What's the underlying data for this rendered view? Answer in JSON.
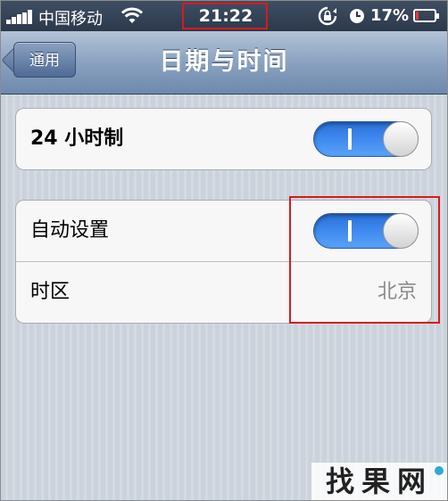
{
  "status_bar": {
    "carrier": "中国移动",
    "time": "21:22",
    "battery_percent": "17%",
    "battery_level": 0.17,
    "icons": [
      "signal-icon",
      "wifi-icon",
      "rotation-lock-icon",
      "alarm-icon",
      "battery-icon"
    ]
  },
  "nav": {
    "back_label": "通用",
    "title": "日期与时间"
  },
  "settings": {
    "group1": {
      "row_24h": {
        "label": "24 小时制",
        "toggle": "on"
      }
    },
    "group2": {
      "auto_set": {
        "label": "自动设置",
        "toggle": "on"
      },
      "timezone": {
        "label": "时区",
        "value": "北京"
      }
    }
  },
  "watermark": {
    "text": "找果网"
  },
  "colors": {
    "toggle_on": "#3f8af0",
    "highlight": "#d9191e",
    "nav_bar": "#8aa2c0"
  }
}
